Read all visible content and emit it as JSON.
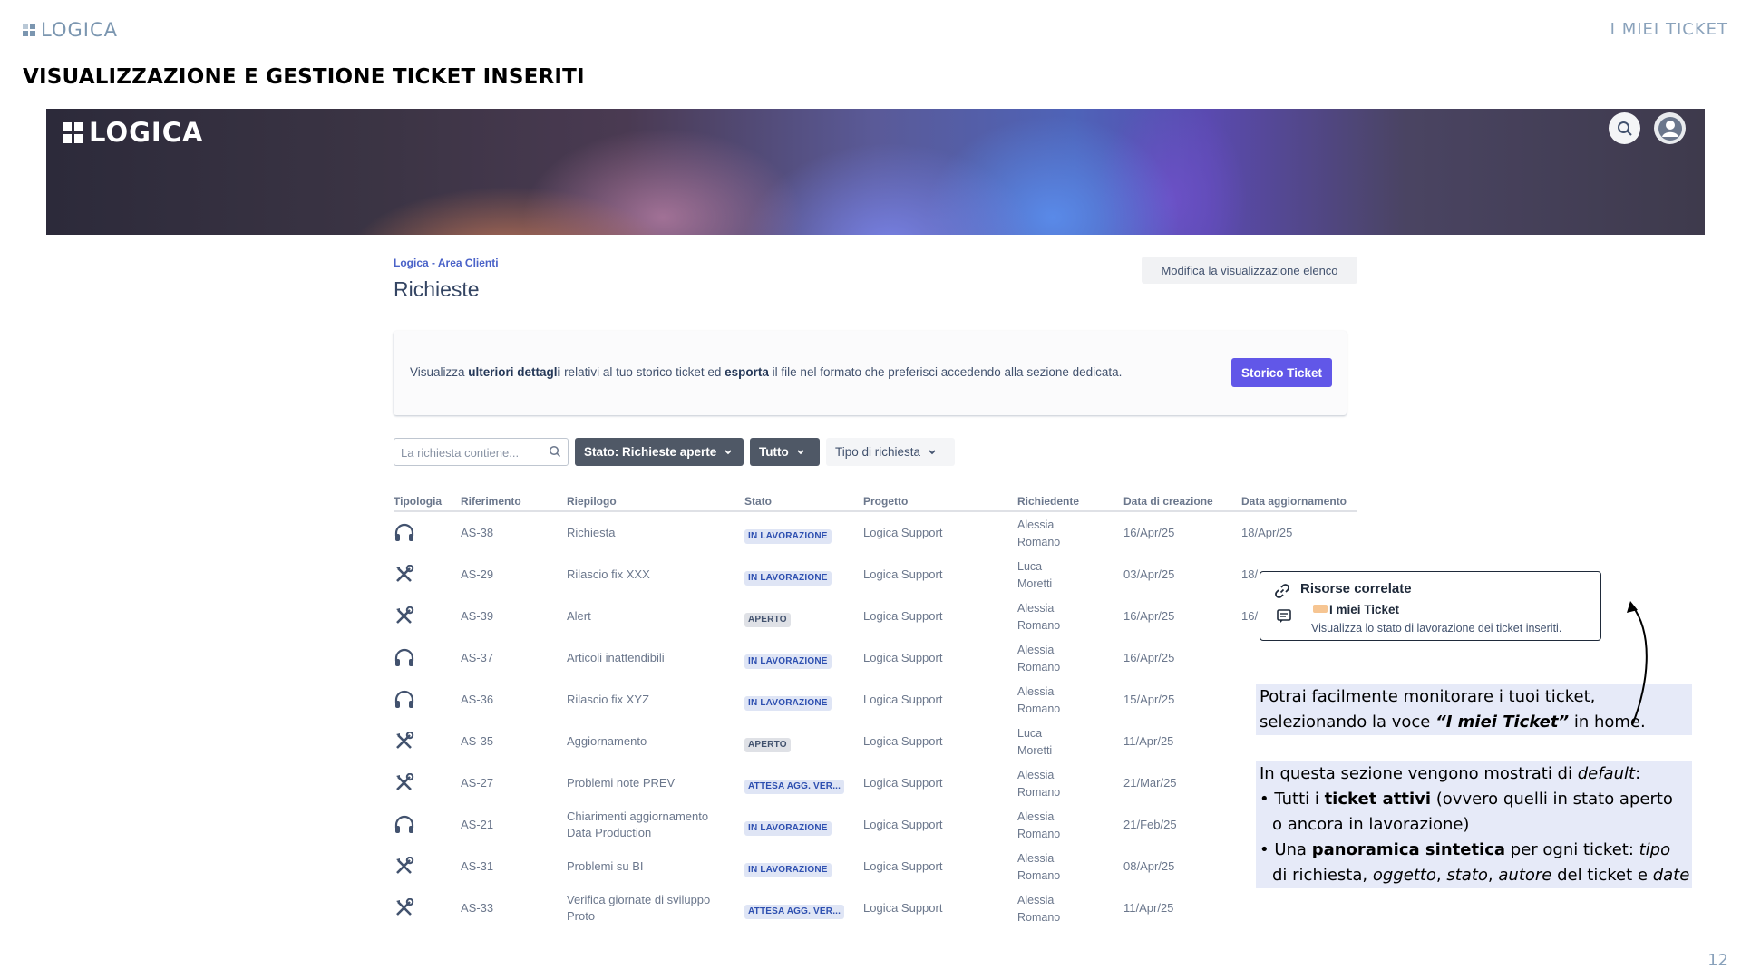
{
  "slide": {
    "logo_text": "LOGICA",
    "section": "I MIEI TICKET",
    "title": "VISUALIZZAZIONE E GESTIONE TICKET INSERITI",
    "page_number": "12"
  },
  "banner": {
    "logo_text": "LOGICA",
    "icons": [
      "search-icon",
      "profile-icon"
    ]
  },
  "portal": {
    "breadcrumb": "Logica - Area Clienti",
    "heading": "Richieste",
    "edit_view_label": "Modifica la visualizzazione elenco",
    "info": {
      "p1": "Visualizza ",
      "b1": "ulteriori dettagli",
      "p2": " relativi al tuo storico ticket ed ",
      "b2": "esporta",
      "p3": " il file nel formato che preferisci accedendo alla sezione dedicata.",
      "button": "Storico Ticket"
    },
    "filters": {
      "search_placeholder": "La richiesta contiene...",
      "stato": "Stato: Richieste aperte",
      "tutto": "Tutto",
      "tipo": "Tipo di richiesta"
    },
    "columns": {
      "tipologia": "Tipologia",
      "riferimento": "Riferimento",
      "riepilogo": "Riepilogo",
      "stato": "Stato",
      "progetto": "Progetto",
      "richiedente": "Richiedente",
      "data_creazione": "Data di creazione",
      "data_aggiornamento": "Data aggiornamento"
    },
    "rows": [
      {
        "icon": "headset-icon",
        "ref": "AS-38",
        "riepilogo": "Richiesta",
        "stato": "IN LAVORAZIONE",
        "progetto": "Logica Support",
        "rich1": "Alessia",
        "rich2": "Romano",
        "dc": "16/Apr/25",
        "da": "18/Apr/25"
      },
      {
        "icon": "tools-icon",
        "ref": "AS-29",
        "riepilogo": "Rilascio fix XXX",
        "stato": "IN LAVORAZIONE",
        "progetto": "Logica Support",
        "rich1": "Luca",
        "rich2": "Moretti",
        "dc": "03/Apr/25",
        "da": "18/"
      },
      {
        "icon": "tools-icon",
        "ref": "AS-39",
        "riepilogo": "Alert",
        "stato": "APERTO",
        "progetto": "Logica Support",
        "rich1": "Alessia",
        "rich2": "Romano",
        "dc": "16/Apr/25",
        "da": "16/"
      },
      {
        "icon": "headset-icon",
        "ref": "AS-37",
        "riepilogo": "Articoli inattendibili",
        "stato": "IN LAVORAZIONE",
        "progetto": "Logica Support",
        "rich1": "Alessia",
        "rich2": "Romano",
        "dc": "16/Apr/25",
        "da": ""
      },
      {
        "icon": "headset-icon",
        "ref": "AS-36",
        "riepilogo": "Rilascio fix XYZ",
        "stato": "IN LAVORAZIONE",
        "progetto": "Logica Support",
        "rich1": "Alessia",
        "rich2": "Romano",
        "dc": "15/Apr/25",
        "da": ""
      },
      {
        "icon": "tools-icon",
        "ref": "AS-35",
        "riepilogo": "Aggiornamento",
        "stato": "APERTO",
        "progetto": "Logica Support",
        "rich1": "Luca",
        "rich2": "Moretti",
        "dc": "11/Apr/25",
        "da": ""
      },
      {
        "icon": "tools-icon",
        "ref": "AS-27",
        "riepilogo": "Problemi note PREV",
        "stato": "ATTESA AGG. VER...",
        "progetto": "Logica Support",
        "rich1": "Alessia",
        "rich2": "Romano",
        "dc": "21/Mar/25",
        "da": ""
      },
      {
        "icon": "headset-icon",
        "ref": "AS-21",
        "riepilogo": "Chiarimenti aggiornamento",
        "riepilogo2": "Data Production",
        "stato": "IN LAVORAZIONE",
        "progetto": "Logica Support",
        "rich1": "Alessia",
        "rich2": "Romano",
        "dc": "21/Feb/25",
        "da": ""
      },
      {
        "icon": "tools-icon",
        "ref": "AS-31",
        "riepilogo": "Problemi su BI",
        "stato": "IN LAVORAZIONE",
        "progetto": "Logica Support",
        "rich1": "Alessia",
        "rich2": "Romano",
        "dc": "08/Apr/25",
        "da": ""
      },
      {
        "icon": "tools-icon",
        "ref": "AS-33",
        "riepilogo": "Verifica giornate di sviluppo",
        "riepilogo2": "Proto",
        "stato": "ATTESA AGG. VER...",
        "progetto": "Logica Support",
        "rich1": "Alessia",
        "rich2": "Romano",
        "dc": "11/Apr/25",
        "da": ""
      }
    ]
  },
  "tooltip": {
    "title": "Risorse correlate",
    "item": "I miei Ticket",
    "desc": "Visualizza lo stato di lavorazione dei ticket inseriti."
  },
  "callout": {
    "l1": "Potrai facilmente monitorare i tuoi ticket,",
    "l2a": "selezionando la voce ",
    "l2b": "“I miei Ticket”",
    "l2c": " in home.",
    "l3a": "In questa sezione vengono mostrati di ",
    "l3b": "default",
    "l3c": ":",
    "l4a": "• Tutti i ",
    "l4b": "ticket attivi",
    "l4c": " (ovvero quelli in stato aperto",
    "l5": "o ancora in lavorazione)",
    "l6a": "• Una ",
    "l6b": "panoramica sintetica",
    "l6c": " per ogni ticket: ",
    "l6d": "tipo",
    "l7a": "di richiesta, ",
    "l7b": "oggetto",
    "l7c": ", ",
    "l7d": "stato",
    "l7e": ", ",
    "l7f": "autore",
    "l7g": " del ticket e ",
    "l7h": "date"
  }
}
